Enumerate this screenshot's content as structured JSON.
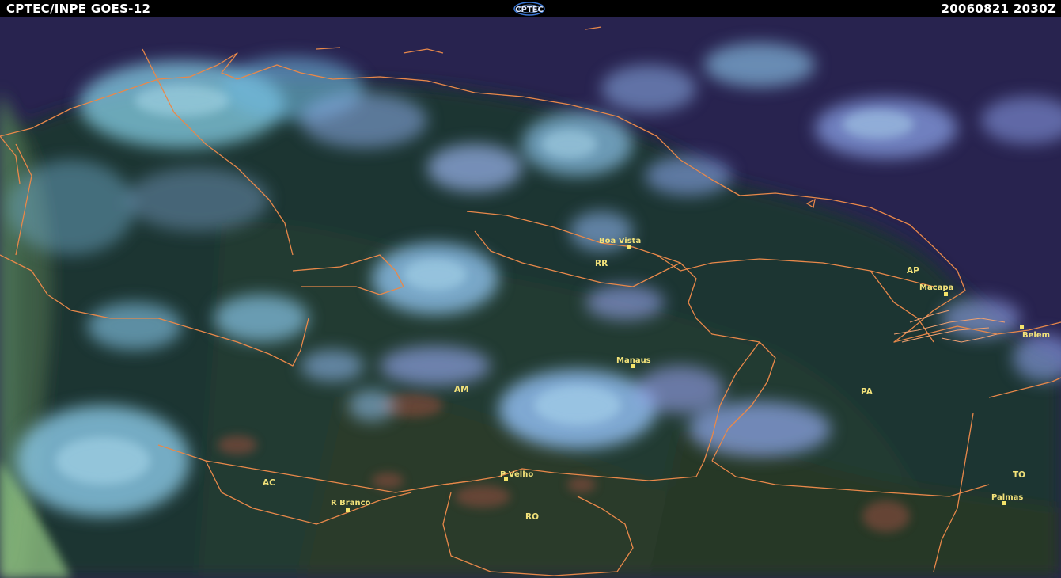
{
  "header": {
    "title": "CPTEC/INPE  GOES-12",
    "logo_text": "CPTEC",
    "timestamp": "20060821 2030Z"
  },
  "colors": {
    "background": "#2a2552",
    "forest": "#1f3a2e",
    "cloud": "#7fc8e8",
    "cloud_high": "#8fa0f0",
    "borders": "#e8884a",
    "labels": "#f2e27a"
  },
  "states": [
    {
      "id": "rr",
      "label": "RR"
    },
    {
      "id": "ap",
      "label": "AP"
    },
    {
      "id": "am",
      "label": "AM"
    },
    {
      "id": "pa",
      "label": "PA"
    },
    {
      "id": "ac",
      "label": "AC"
    },
    {
      "id": "ro",
      "label": "RO"
    },
    {
      "id": "to",
      "label": "TO"
    }
  ],
  "cities": [
    {
      "id": "boa-vista",
      "label": "Boa Vista"
    },
    {
      "id": "macapa",
      "label": "Macapa"
    },
    {
      "id": "belem",
      "label": "Belem"
    },
    {
      "id": "manaus",
      "label": "Manaus"
    },
    {
      "id": "p-velho",
      "label": "P Velho"
    },
    {
      "id": "r-branco",
      "label": "R Branco"
    },
    {
      "id": "palmas",
      "label": "Palmas"
    }
  ]
}
